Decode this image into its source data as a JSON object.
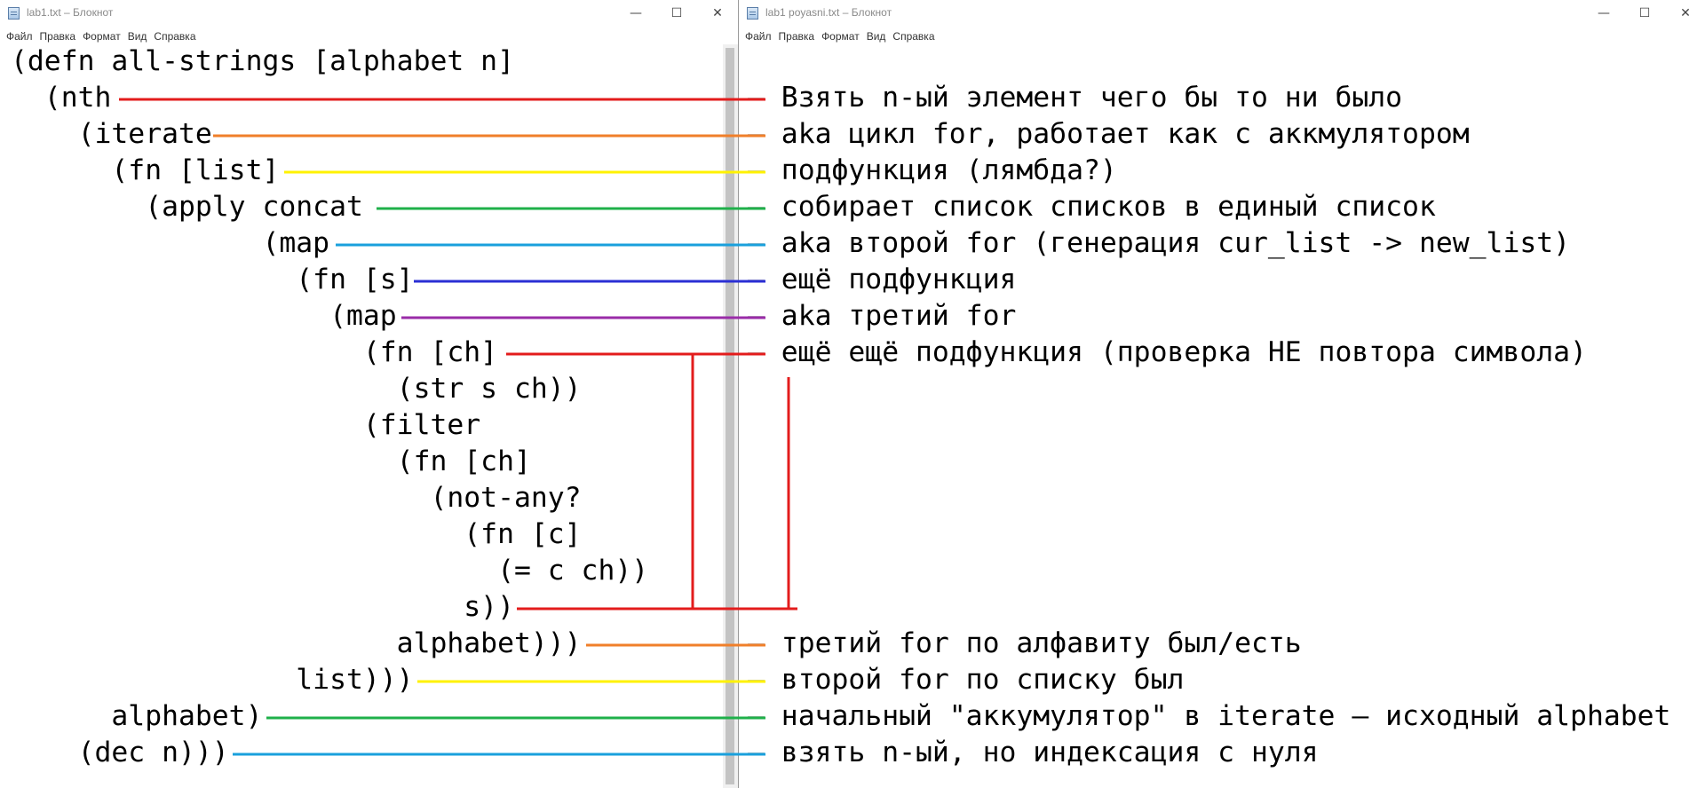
{
  "left_window": {
    "title": "lab1.txt – Блокнот",
    "controls": {
      "minimize": "—",
      "maximize": "☐",
      "close": "✕"
    },
    "menu": [
      "Файл",
      "Правка",
      "Формат",
      "Вид",
      "Справка"
    ],
    "lines": [
      "(defn all-strings [alphabet n]",
      "  (nth",
      "    (iterate",
      "      (fn [list]",
      "        (apply concat",
      "               (map",
      "                 (fn [s]",
      "                   (map",
      "                     (fn [ch]",
      "                       (str s ch))",
      "                     (filter",
      "                       (fn [ch]",
      "                         (not-any?",
      "                           (fn [c]",
      "                             (= c ch))",
      "                           s))",
      "                       alphabet)))",
      "                 list)))",
      "      alphabet)",
      "    (dec n)))"
    ]
  },
  "right_window": {
    "title": "lab1 poyasni.txt – Блокнот",
    "controls": {
      "minimize": "—",
      "maximize": "☐",
      "close": "✕"
    },
    "menu": [
      "Файл",
      "Правка",
      "Формат",
      "Вид",
      "Справка"
    ],
    "annotations": [
      "— Взять n-ый элемент чего бы то ни было",
      "— aka цикл for, работает как с аккмулятором",
      "— подфункция (лямбда?)",
      "— собирает список списков в единый список",
      "— aka второй for (генерация cur_list -> new_list)",
      "— ещё подфункция",
      "— aka третий for",
      "— ещё ещё подфункция (проверка НЕ повтора символа)",
      "— третий for по алфавиту был/есть",
      "— второй for по списку был",
      "— начальный \"аккумулятор\" в iterate — исходный alphabet",
      "— взять n-ый, но индексация с нуля"
    ]
  },
  "connector_colors": {
    "red": "#e31c1c",
    "orange": "#f07f2a",
    "yellow": "#fff200",
    "green": "#1fb04a",
    "cyan": "#1aa0dc",
    "blue": "#2b2fd4",
    "purple": "#9a2ca8"
  }
}
